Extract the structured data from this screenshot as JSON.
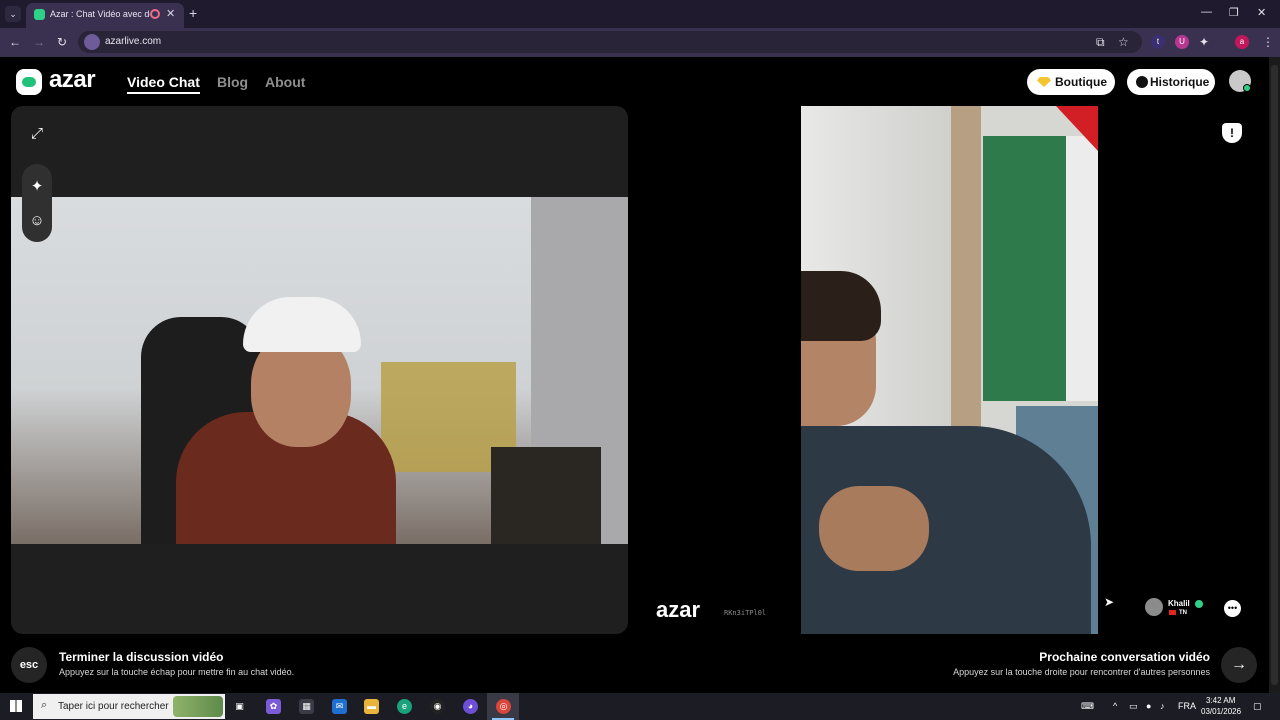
{
  "browser": {
    "tab_title": "Azar : Chat Vidéo avec de n",
    "url": "azarlive.com",
    "new_tab": "+",
    "close": "✕"
  },
  "site": {
    "logo": "azar",
    "nav": [
      "Video Chat",
      "Blog",
      "About"
    ],
    "shop_label": "Boutique",
    "history_label": "Historique"
  },
  "partner": {
    "watermark": "azar",
    "watermark_id": "RKn3iTPl0l",
    "name": "Khalil",
    "country": "TN"
  },
  "bottom": {
    "esc_key": "esc",
    "end_title": "Terminer la discussion vidéo",
    "end_desc": "Appuyez sur la touche échap pour mettre fin au chat vidéo.",
    "next_title": "Prochaine conversation vidéo",
    "next_desc": "Appuyez sur la touche droite pour rencontrer d'autres personnes"
  },
  "taskbar": {
    "search_placeholder": "Taper ici pour rechercher",
    "language": "FRA",
    "time": "3:42 AM",
    "date": "03/01/2026"
  },
  "colors": {
    "brand_green": "#22c17a",
    "background": "#000000",
    "panel": "#1f1f1f"
  }
}
